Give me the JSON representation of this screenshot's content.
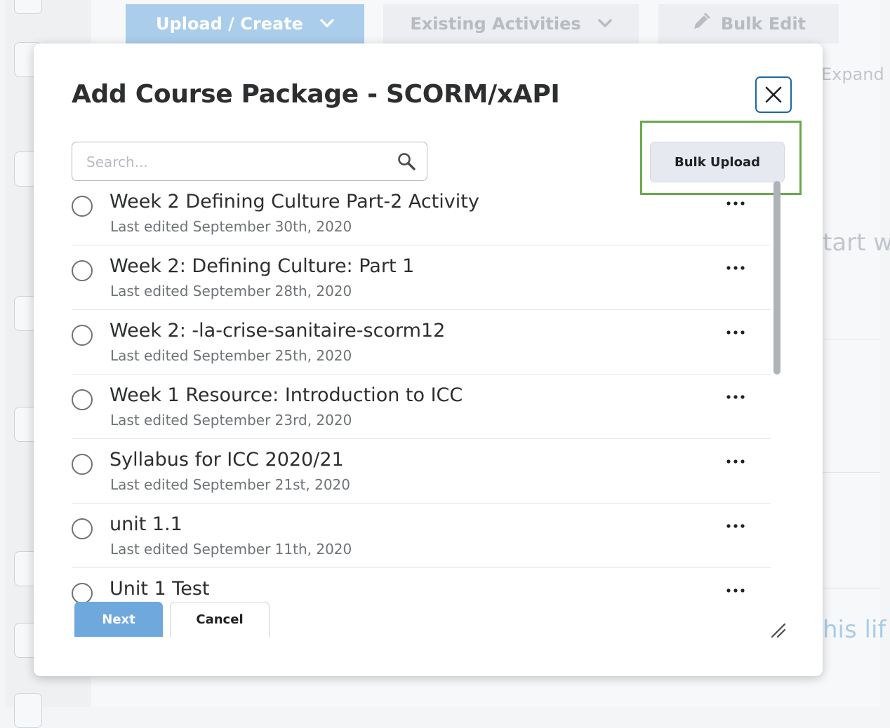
{
  "background": {
    "toolbar": {
      "upload_label": "Upload / Create",
      "existing_label": "Existing Activities",
      "bulk_edit_label": "Bulk Edit"
    },
    "side_texts": {
      "expand": "Expand",
      "start": "tart w",
      "this_life": "his lif"
    }
  },
  "dialog": {
    "title": "Add Course Package - SCORM/xAPI",
    "search_placeholder": "Search...",
    "bulk_upload_label": "Bulk Upload",
    "items": [
      {
        "name": "Week 2 Defining Culture Part-2 Activity",
        "meta": "Last edited September 30th, 2020"
      },
      {
        "name": "Week 2: Defining Culture: Part 1",
        "meta": "Last edited September 28th, 2020"
      },
      {
        "name": "Week 2: -la-crise-sanitaire-scorm12",
        "meta": "Last edited September 25th, 2020"
      },
      {
        "name": "Week 1 Resource: Introduction to ICC",
        "meta": "Last edited September 23rd, 2020"
      },
      {
        "name": "Syllabus for ICC 2020/21",
        "meta": "Last edited September 21st, 2020"
      },
      {
        "name": "unit 1.1",
        "meta": "Last edited September 11th, 2020"
      },
      {
        "name": "Unit 1 Test",
        "meta": ""
      }
    ],
    "next_label": "Next",
    "cancel_label": "Cancel"
  },
  "colors": {
    "primary": "#6fa8dc",
    "focus_border": "#1c67a5",
    "highlight": "#6aa84f"
  }
}
